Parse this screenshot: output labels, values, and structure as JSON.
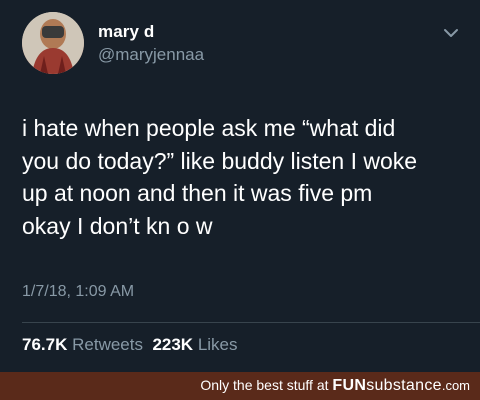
{
  "user": {
    "display_name": "mary d",
    "handle": "@maryjennaa"
  },
  "tweet": {
    "lines": [
      "i hate when people ask me “what did",
      "you do today?” like buddy listen I woke",
      "up at noon and then it was five pm",
      "okay I don’t kn o w"
    ],
    "timestamp": "1/7/18, 1:09 AM"
  },
  "stats": {
    "retweets_count": "76.7K",
    "retweets_label": "Retweets",
    "likes_count": "223K",
    "likes_label": "Likes"
  },
  "footer": {
    "tagline": "Only the best stuff at",
    "brand_fun": "FUN",
    "brand_rest": "substance",
    "brand_domain": ".com"
  },
  "colors": {
    "background": "#161f29",
    "secondary_text": "#8899a6",
    "divider": "#38444d",
    "footer_bg": "#5a2a1a"
  },
  "icons": {
    "menu": "chevron-down-icon",
    "profile": "avatar"
  }
}
